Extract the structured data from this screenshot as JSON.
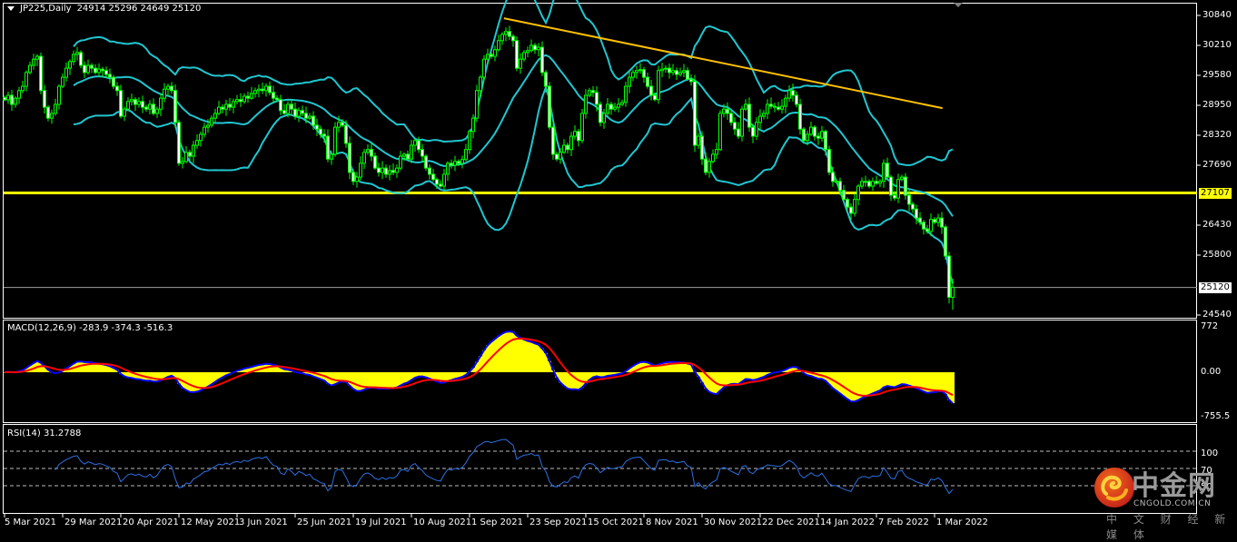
{
  "header": {
    "symbol": "JP225,Daily",
    "ohlc": "24914 25296 24649 25120"
  },
  "colors": {
    "background": "#000000",
    "candle": "#00ff00",
    "bear_body": "#ffffff",
    "bollinger": "#20c6d0",
    "support": "#ffff00",
    "trendline": "#ffc000",
    "bid_line": "#a0a0a0",
    "macd_hist": "#ffff00",
    "macd_main": "#0000ff",
    "macd_signal": "#ff0000",
    "rsi_line": "#2f6fe0",
    "axis": "#ffffff"
  },
  "price_axis": {
    "ticks": [
      "30840",
      "30210",
      "29580",
      "28950",
      "28320",
      "27690",
      "26430",
      "25800",
      "24540"
    ],
    "range": [
      24540,
      30840
    ]
  },
  "support_line": {
    "price": 27107,
    "label": "27107"
  },
  "bid_line": {
    "price": 25120,
    "label": "25120"
  },
  "trendline": {
    "from": {
      "date": "14 Sep 2021",
      "price": 30780
    },
    "to": {
      "date": "4 Mar 2022",
      "price": 28890
    }
  },
  "x_axis": {
    "labels": [
      "5 Mar 2021",
      "29 Mar 2021",
      "20 Apr 2021",
      "12 May 2021",
      "3 Jun 2021",
      "25 Jun 2021",
      "19 Jul 2021",
      "10 Aug 2021",
      "1 Sep 2021",
      "23 Sep 2021",
      "15 Oct 2021",
      "8 Nov 2021",
      "30 Nov 2021",
      "22 Dec 2021",
      "14 Jan 2022",
      "7 Feb 2022",
      "1 Mar 2022"
    ]
  },
  "chart_data": {
    "type": "candlestick",
    "title": "JP225,Daily",
    "indicators": {
      "bollinger": {
        "period": 20,
        "deviation": 2
      }
    },
    "last_bar": {
      "open": 24914,
      "high": 25296,
      "low": 24649,
      "close": 25120
    },
    "closes": [
      29065,
      29160,
      28970,
      29100,
      29260,
      29350,
      29640,
      29790,
      29920,
      29980,
      29260,
      28910,
      28680,
      28780,
      28970,
      29350,
      29540,
      29730,
      29870,
      30020,
      30060,
      29790,
      29640,
      29790,
      29730,
      29640,
      29710,
      29680,
      29600,
      29540,
      29350,
      29260,
      28720,
      28870,
      29030,
      29070,
      28970,
      29030,
      28910,
      28870,
      28970,
      28780,
      28870,
      29100,
      29290,
      29350,
      29260,
      28590,
      27730,
      27770,
      27960,
      27880,
      28110,
      28210,
      28340,
      28490,
      28530,
      28680,
      28780,
      28910,
      28870,
      28970,
      28910,
      29030,
      29070,
      29030,
      29140,
      29100,
      29200,
      29260,
      29290,
      29260,
      29350,
      29220,
      29100,
      29070,
      28840,
      28780,
      28970,
      28870,
      28720,
      28840,
      28780,
      28680,
      28720,
      28530,
      28450,
      28340,
      28300,
      27820,
      27920,
      28490,
      28590,
      28530,
      28150,
      27540,
      27350,
      27440,
      27730,
      27960,
      28020,
      27880,
      27630,
      27540,
      27630,
      27500,
      27580,
      27540,
      27630,
      27880,
      27920,
      27820,
      28110,
      28210,
      28020,
      27880,
      27630,
      27500,
      27390,
      27290,
      27250,
      27500,
      27730,
      27690,
      27770,
      27730,
      27810,
      28020,
      28400,
      28680,
      29260,
      29540,
      29920,
      30020,
      29980,
      30120,
      30310,
      30440,
      30500,
      30400,
      30310,
      29730,
      29920,
      30060,
      30100,
      30210,
      30120,
      30170,
      29640,
      29350,
      28490,
      27920,
      27820,
      27960,
      28110,
      28020,
      28300,
      28400,
      28210,
      28780,
      29160,
      29260,
      29220,
      28970,
      28590,
      28780,
      28970,
      28870,
      28910,
      28970,
      29010,
      29350,
      29540,
      29640,
      29680,
      29700,
      29540,
      29350,
      29160,
      29070,
      29680,
      29710,
      29730,
      29640,
      29680,
      29600,
      29640,
      29680,
      29500,
      29450,
      28110,
      28300,
      27820,
      27540,
      27770,
      27920,
      28020,
      28780,
      28870,
      28780,
      28590,
      28450,
      28300,
      28870,
      28970,
      28490,
      28300,
      28590,
      28720,
      28780,
      28970,
      28930,
      28910,
      28870,
      28930,
      29100,
      29260,
      29160,
      28970,
      28450,
      28210,
      28340,
      28490,
      28300,
      28260,
      28400,
      28020,
      27540,
      27350,
      27350,
      27160,
      26970,
      26810,
      26680,
      26970,
      27250,
      27350,
      27350,
      27250,
      27350,
      27310,
      27350,
      27730,
      27440,
      27060,
      27000,
      27390,
      27440,
      27060,
      26870,
      26770,
      26580,
      26490,
      26350,
      26300,
      26550,
      26490,
      26580,
      26390,
      25780,
      24914,
      25120
    ]
  },
  "macd": {
    "label": "MACD(12,26,9) -283.9 -374.3 -516.3",
    "ticks": [
      "772",
      "0.00",
      "-755.5"
    ],
    "range": [
      -755.5,
      772
    ]
  },
  "rsi": {
    "label": "RSI(14) 31.2788",
    "ticks": [
      "100",
      "70",
      "50"
    ],
    "levels": [
      70,
      50,
      30
    ]
  },
  "logo": {
    "name": "中金网",
    "domain": "CNGOLD.COM.CN",
    "tagline": "中 文 财 经 新 媒 体"
  }
}
